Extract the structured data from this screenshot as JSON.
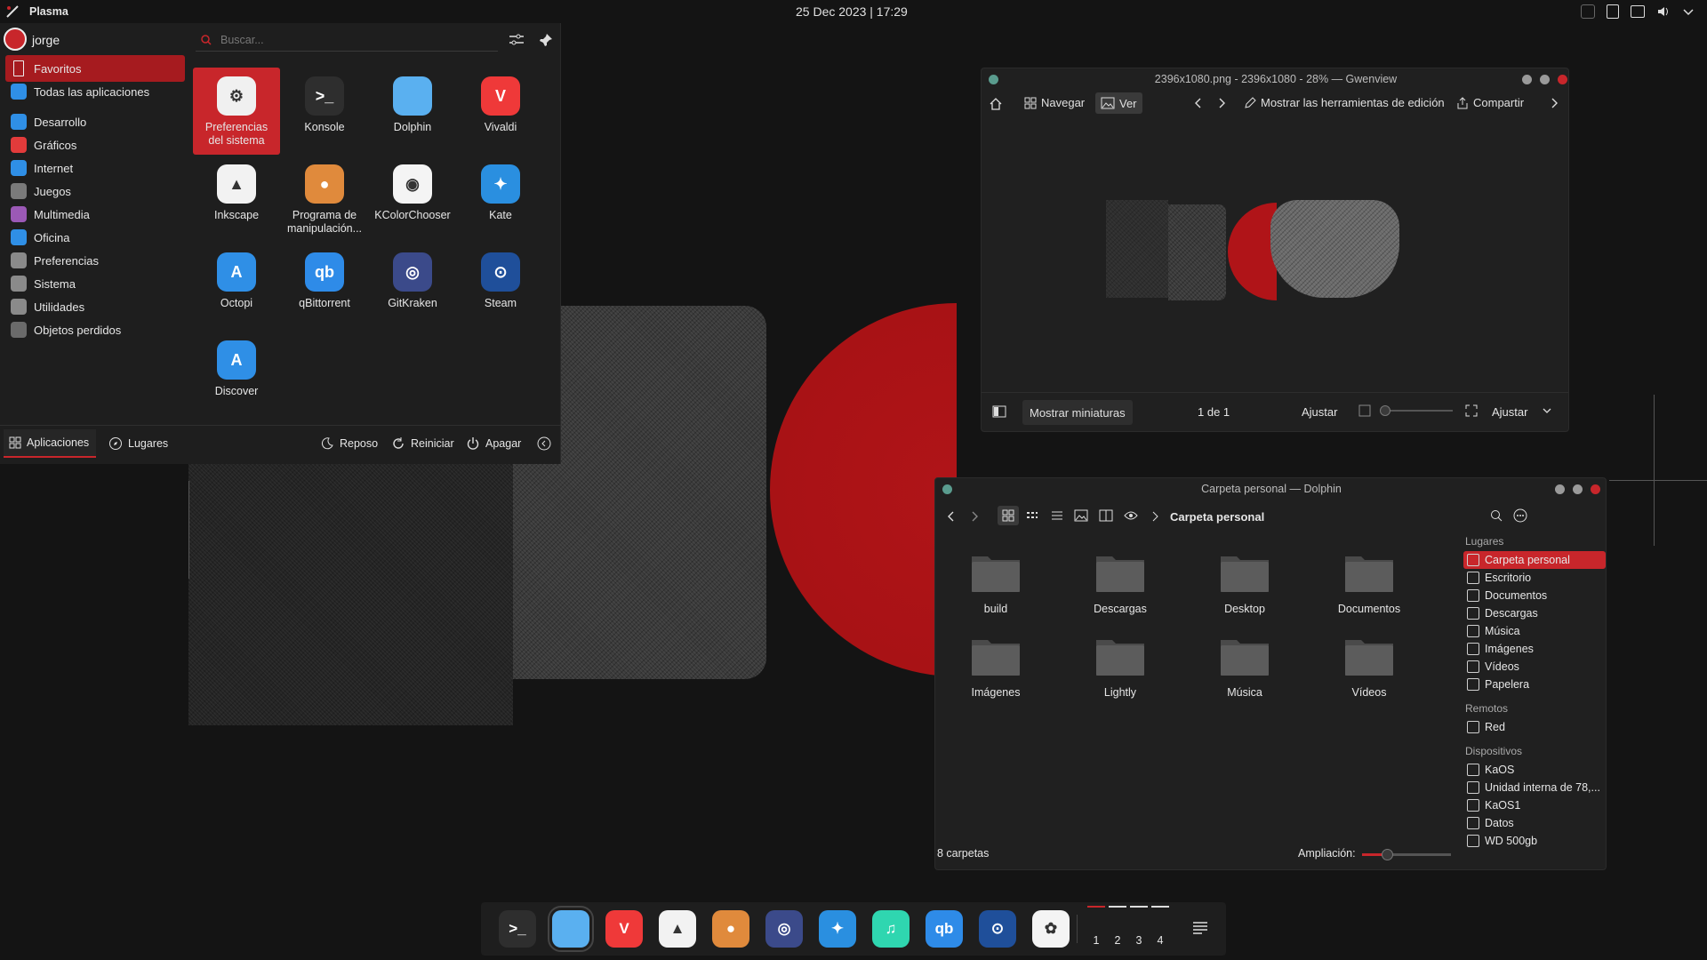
{
  "topbar": {
    "plasma_label": "Plasma",
    "clock": "25 Dec 2023 | 17:29"
  },
  "launcher": {
    "user": "jorge",
    "search_placeholder": "Buscar...",
    "categories": [
      {
        "label": "Favoritos",
        "color": "#a61b1f"
      },
      {
        "label": "Todas las aplicaciones",
        "color": "#2f8fe6"
      },
      {
        "label": "Desarrollo",
        "color": "#2f8fe6"
      },
      {
        "label": "Gráficos",
        "color": "#e23b3b"
      },
      {
        "label": "Internet",
        "color": "#2f8fe6"
      },
      {
        "label": "Juegos",
        "color": "#7a7a7a"
      },
      {
        "label": "Multimedia",
        "color": "#9b59b6"
      },
      {
        "label": "Oficina",
        "color": "#2f8fe6"
      },
      {
        "label": "Preferencias",
        "color": "#8a8a8a"
      },
      {
        "label": "Sistema",
        "color": "#8a8a8a"
      },
      {
        "label": "Utilidades",
        "color": "#8a8a8a"
      },
      {
        "label": "Objetos perdidos",
        "color": "#6a6a6a"
      }
    ],
    "apps": [
      {
        "label": "Preferencias del sistema",
        "icon": "settings-icon",
        "color": "#f0f0f0",
        "glyph": "⚙"
      },
      {
        "label": "Konsole",
        "icon": "terminal-icon",
        "color": "#2e2e2e",
        "glyph": ">_"
      },
      {
        "label": "Dolphin",
        "icon": "folder-icon",
        "color": "#5ab0f0",
        "glyph": ""
      },
      {
        "label": "Vivaldi",
        "icon": "vivaldi-icon",
        "color": "#ef3939",
        "glyph": "V"
      },
      {
        "label": "Inkscape",
        "icon": "inkscape-icon",
        "color": "#f2f2f2",
        "glyph": "▲"
      },
      {
        "label": "Programa de manipulación...",
        "icon": "gimp-icon",
        "color": "#e08a3c",
        "glyph": "●"
      },
      {
        "label": "KColorChooser",
        "icon": "color-chooser-icon",
        "color": "#f4f4f4",
        "glyph": "◉"
      },
      {
        "label": "Kate",
        "icon": "kate-icon",
        "color": "#2a8fe0",
        "glyph": "✦"
      },
      {
        "label": "Octopi",
        "icon": "octopi-icon",
        "color": "#2f8fe6",
        "glyph": "A"
      },
      {
        "label": "qBittorrent",
        "icon": "qbittorrent-icon",
        "color": "#2e8be8",
        "glyph": "qb"
      },
      {
        "label": "GitKraken",
        "icon": "gitkraken-icon",
        "color": "#3b4a8a",
        "glyph": "◎"
      },
      {
        "label": "Steam",
        "icon": "steam-icon",
        "color": "#1f4f9a",
        "glyph": "⊙"
      },
      {
        "label": "Discover",
        "icon": "discover-icon",
        "color": "#2f8fe6",
        "glyph": "A"
      }
    ],
    "footer": {
      "apps_tab": "Aplicaciones",
      "places_tab": "Lugares",
      "sleep": "Reposo",
      "restart": "Reiniciar",
      "shutdown": "Apagar"
    }
  },
  "gwenview": {
    "title": "2396x1080.png - 2396x1080 - 28% — Gwenview",
    "browse": "Navegar",
    "view": "Ver",
    "edit_tools": "Mostrar las herramientas de edición",
    "share": "Compartir",
    "thumbnails": "Mostrar miniaturas",
    "page": "1 de 1",
    "fit": "Ajustar",
    "fit2": "Ajustar"
  },
  "dolphin": {
    "title": "Carpeta personal — Dolphin",
    "breadcrumb": "Carpeta personal",
    "folders": [
      {
        "label": "build",
        "icon": "folder-icon"
      },
      {
        "label": "Descargas",
        "icon": "download-folder-icon"
      },
      {
        "label": "Desktop",
        "icon": "desktop-folder-icon"
      },
      {
        "label": "Documentos",
        "icon": "documents-folder-icon"
      },
      {
        "label": "Imágenes",
        "icon": "pictures-folder-icon"
      },
      {
        "label": "Lightly",
        "icon": "folder-icon"
      },
      {
        "label": "Música",
        "icon": "music-folder-icon"
      },
      {
        "label": "Vídeos",
        "icon": "videos-folder-icon"
      }
    ],
    "places_header": "Lugares",
    "places": [
      "Carpeta personal",
      "Escritorio",
      "Documentos",
      "Descargas",
      "Música",
      "Imágenes",
      "Vídeos",
      "Papelera"
    ],
    "remote_header": "Remotos",
    "remote": [
      "Red"
    ],
    "devices_header": "Dispositivos",
    "devices": [
      "KaOS",
      "Unidad interna de 78,...",
      "KaOS1",
      "Datos",
      "WD 500gb"
    ],
    "status": "8 carpetas",
    "zoom_label": "Ampliación:"
  },
  "dock": {
    "apps": [
      {
        "icon": "terminal-icon",
        "color": "#2e2e2e",
        "glyph": ">_"
      },
      {
        "icon": "folder-icon",
        "color": "#5ab0f0",
        "glyph": ""
      },
      {
        "icon": "vivaldi-icon",
        "color": "#ef3939",
        "glyph": "V"
      },
      {
        "icon": "inkscape-icon",
        "color": "#f2f2f2",
        "glyph": "▲"
      },
      {
        "icon": "gimp-icon",
        "color": "#e08a3c",
        "glyph": "●"
      },
      {
        "icon": "gitkraken-icon",
        "color": "#3b4a8a",
        "glyph": "◎"
      },
      {
        "icon": "kate-icon",
        "color": "#2a8fe0",
        "glyph": "✦"
      },
      {
        "icon": "music-icon",
        "color": "#2fd6b0",
        "glyph": "♫"
      },
      {
        "icon": "qbittorrent-icon",
        "color": "#2e8be8",
        "glyph": "qb"
      },
      {
        "icon": "steam-icon",
        "color": "#1f4f9a",
        "glyph": "⊙"
      },
      {
        "icon": "photos-icon",
        "color": "#f4f4f4",
        "glyph": "✿"
      }
    ],
    "desktops": [
      "1",
      "2",
      "3",
      "4"
    ]
  },
  "colors": {
    "accent": "#c8262b",
    "panel": "#1e1e1e",
    "bg": "#141414"
  }
}
